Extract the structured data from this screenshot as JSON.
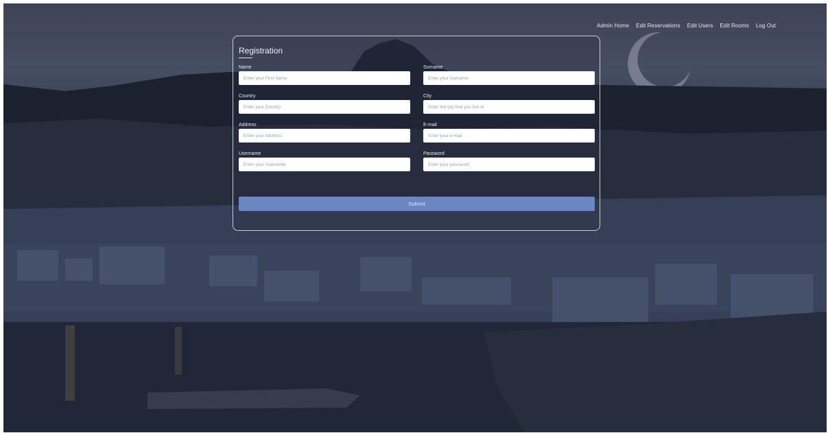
{
  "nav": {
    "links": [
      "Admin Home",
      "Edit Reservations",
      "Edit Users",
      "Edit Rooms",
      "Log Out"
    ]
  },
  "form": {
    "title": "Registration",
    "fields": [
      {
        "label": "Name",
        "placeholder": "Enter your First Name"
      },
      {
        "label": "Surname",
        "placeholder": "Enter your Surname"
      },
      {
        "label": "Country",
        "placeholder": "Enter your Country"
      },
      {
        "label": "City",
        "placeholder": "Enter the city that you live in"
      },
      {
        "label": "Address",
        "placeholder": "Enter your Address"
      },
      {
        "label": "E-mail",
        "placeholder": "Enter your e-mail"
      },
      {
        "label": "Username",
        "placeholder": "Enter your Username"
      },
      {
        "label": "Password",
        "placeholder": "Enter your password"
      }
    ],
    "submit_label": "Submit"
  },
  "colors": {
    "submit_button": "#6b87c2",
    "overlay": "#2a3042"
  }
}
